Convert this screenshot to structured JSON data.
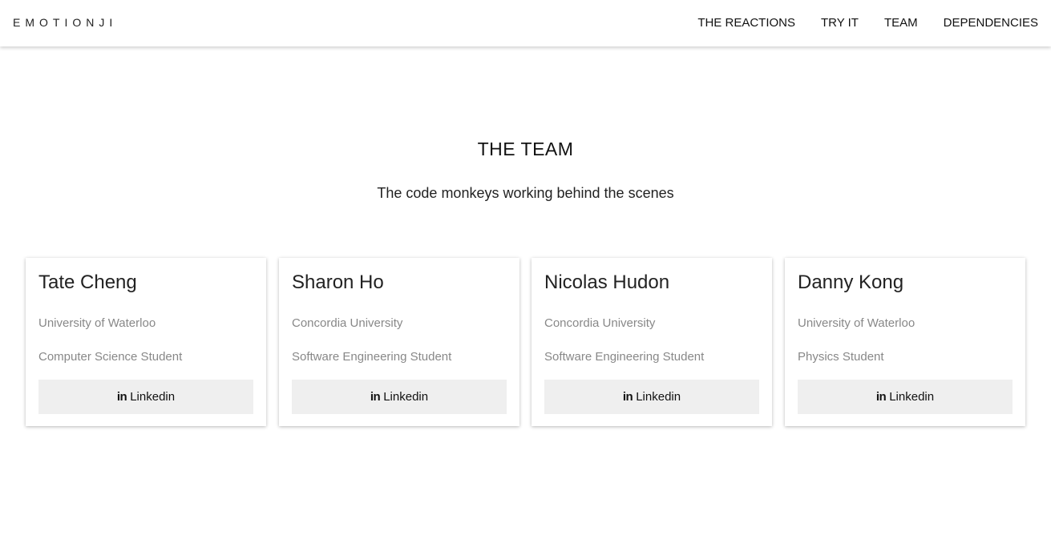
{
  "brand": "EMOTIONJI",
  "nav": {
    "items": [
      {
        "label": "THE REACTIONS"
      },
      {
        "label": "TRY IT"
      },
      {
        "label": "TEAM"
      },
      {
        "label": "DEPENDENCIES"
      }
    ]
  },
  "section": {
    "title": "THE TEAM",
    "subtitle": "The code monkeys working behind the scenes"
  },
  "team": [
    {
      "name": "Tate Cheng",
      "school": "University of Waterloo",
      "role": "Computer Science Student",
      "link_label": "Linkedin",
      "link_icon": "in"
    },
    {
      "name": "Sharon Ho",
      "school": "Concordia University",
      "role": "Software Engineering Student",
      "link_label": "Linkedin",
      "link_icon": "in"
    },
    {
      "name": "Nicolas Hudon",
      "school": "Concordia University",
      "role": "Software Engineering Student",
      "link_label": "Linkedin",
      "link_icon": "in"
    },
    {
      "name": "Danny Kong",
      "school": "University of Waterloo",
      "role": "Physics Student",
      "link_label": "Linkedin",
      "link_icon": "in"
    }
  ]
}
